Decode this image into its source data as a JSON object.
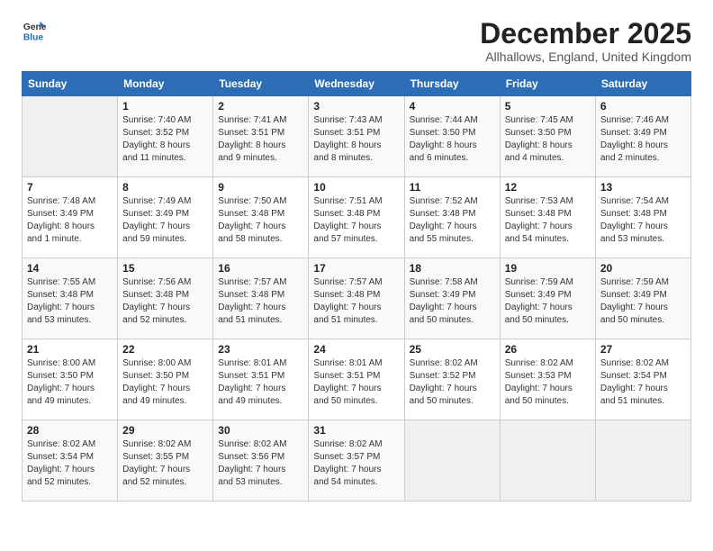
{
  "header": {
    "logo_line1": "General",
    "logo_line2": "Blue",
    "month_year": "December 2025",
    "location": "Allhallows, England, United Kingdom"
  },
  "days_of_week": [
    "Sunday",
    "Monday",
    "Tuesday",
    "Wednesday",
    "Thursday",
    "Friday",
    "Saturday"
  ],
  "weeks": [
    [
      {
        "day": "",
        "info": ""
      },
      {
        "day": "1",
        "info": "Sunrise: 7:40 AM\nSunset: 3:52 PM\nDaylight: 8 hours\nand 11 minutes."
      },
      {
        "day": "2",
        "info": "Sunrise: 7:41 AM\nSunset: 3:51 PM\nDaylight: 8 hours\nand 9 minutes."
      },
      {
        "day": "3",
        "info": "Sunrise: 7:43 AM\nSunset: 3:51 PM\nDaylight: 8 hours\nand 8 minutes."
      },
      {
        "day": "4",
        "info": "Sunrise: 7:44 AM\nSunset: 3:50 PM\nDaylight: 8 hours\nand 6 minutes."
      },
      {
        "day": "5",
        "info": "Sunrise: 7:45 AM\nSunset: 3:50 PM\nDaylight: 8 hours\nand 4 minutes."
      },
      {
        "day": "6",
        "info": "Sunrise: 7:46 AM\nSunset: 3:49 PM\nDaylight: 8 hours\nand 2 minutes."
      }
    ],
    [
      {
        "day": "7",
        "info": "Sunrise: 7:48 AM\nSunset: 3:49 PM\nDaylight: 8 hours\nand 1 minute."
      },
      {
        "day": "8",
        "info": "Sunrise: 7:49 AM\nSunset: 3:49 PM\nDaylight: 7 hours\nand 59 minutes."
      },
      {
        "day": "9",
        "info": "Sunrise: 7:50 AM\nSunset: 3:48 PM\nDaylight: 7 hours\nand 58 minutes."
      },
      {
        "day": "10",
        "info": "Sunrise: 7:51 AM\nSunset: 3:48 PM\nDaylight: 7 hours\nand 57 minutes."
      },
      {
        "day": "11",
        "info": "Sunrise: 7:52 AM\nSunset: 3:48 PM\nDaylight: 7 hours\nand 55 minutes."
      },
      {
        "day": "12",
        "info": "Sunrise: 7:53 AM\nSunset: 3:48 PM\nDaylight: 7 hours\nand 54 minutes."
      },
      {
        "day": "13",
        "info": "Sunrise: 7:54 AM\nSunset: 3:48 PM\nDaylight: 7 hours\nand 53 minutes."
      }
    ],
    [
      {
        "day": "14",
        "info": "Sunrise: 7:55 AM\nSunset: 3:48 PM\nDaylight: 7 hours\nand 53 minutes."
      },
      {
        "day": "15",
        "info": "Sunrise: 7:56 AM\nSunset: 3:48 PM\nDaylight: 7 hours\nand 52 minutes."
      },
      {
        "day": "16",
        "info": "Sunrise: 7:57 AM\nSunset: 3:48 PM\nDaylight: 7 hours\nand 51 minutes."
      },
      {
        "day": "17",
        "info": "Sunrise: 7:57 AM\nSunset: 3:48 PM\nDaylight: 7 hours\nand 51 minutes."
      },
      {
        "day": "18",
        "info": "Sunrise: 7:58 AM\nSunset: 3:49 PM\nDaylight: 7 hours\nand 50 minutes."
      },
      {
        "day": "19",
        "info": "Sunrise: 7:59 AM\nSunset: 3:49 PM\nDaylight: 7 hours\nand 50 minutes."
      },
      {
        "day": "20",
        "info": "Sunrise: 7:59 AM\nSunset: 3:49 PM\nDaylight: 7 hours\nand 50 minutes."
      }
    ],
    [
      {
        "day": "21",
        "info": "Sunrise: 8:00 AM\nSunset: 3:50 PM\nDaylight: 7 hours\nand 49 minutes."
      },
      {
        "day": "22",
        "info": "Sunrise: 8:00 AM\nSunset: 3:50 PM\nDaylight: 7 hours\nand 49 minutes."
      },
      {
        "day": "23",
        "info": "Sunrise: 8:01 AM\nSunset: 3:51 PM\nDaylight: 7 hours\nand 49 minutes."
      },
      {
        "day": "24",
        "info": "Sunrise: 8:01 AM\nSunset: 3:51 PM\nDaylight: 7 hours\nand 50 minutes."
      },
      {
        "day": "25",
        "info": "Sunrise: 8:02 AM\nSunset: 3:52 PM\nDaylight: 7 hours\nand 50 minutes."
      },
      {
        "day": "26",
        "info": "Sunrise: 8:02 AM\nSunset: 3:53 PM\nDaylight: 7 hours\nand 50 minutes."
      },
      {
        "day": "27",
        "info": "Sunrise: 8:02 AM\nSunset: 3:54 PM\nDaylight: 7 hours\nand 51 minutes."
      }
    ],
    [
      {
        "day": "28",
        "info": "Sunrise: 8:02 AM\nSunset: 3:54 PM\nDaylight: 7 hours\nand 52 minutes."
      },
      {
        "day": "29",
        "info": "Sunrise: 8:02 AM\nSunset: 3:55 PM\nDaylight: 7 hours\nand 52 minutes."
      },
      {
        "day": "30",
        "info": "Sunrise: 8:02 AM\nSunset: 3:56 PM\nDaylight: 7 hours\nand 53 minutes."
      },
      {
        "day": "31",
        "info": "Sunrise: 8:02 AM\nSunset: 3:57 PM\nDaylight: 7 hours\nand 54 minutes."
      },
      {
        "day": "",
        "info": ""
      },
      {
        "day": "",
        "info": ""
      },
      {
        "day": "",
        "info": ""
      }
    ]
  ]
}
